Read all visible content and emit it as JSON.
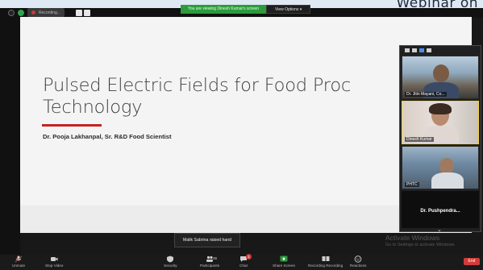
{
  "page": {
    "top_heading_fragment": "Webinar on"
  },
  "meta": {
    "recording_label": "Recording...",
    "viewing_banner": "You are viewing Dinesh Kumar's screen",
    "view_options_label": "View Options ▾"
  },
  "slide": {
    "title": "Pulsed Electric Fields for Food Proc\nTechnology",
    "author": "Dr. Pooja Lakhanpal, Sr. R&D Food Scientist"
  },
  "gallery": {
    "tiles": [
      {
        "name": "Dr. Jitin Mayani, Co..."
      },
      {
        "name": "Dinesh Kumar"
      },
      {
        "name": "PHTC"
      }
    ],
    "active_speaker_name": "Dr. Pushpendra...",
    "scroll_icon": "chevron-down-icon"
  },
  "notification": {
    "text": "Malik Sabrina raised hand"
  },
  "watermark": {
    "title": "Activate Windows",
    "subtitle": "Go to Settings to activate Windows."
  },
  "toolbar": {
    "items": [
      {
        "label": "Unmute",
        "icon": "microphone-icon"
      },
      {
        "label": "Stop Video",
        "icon": "video-camera-icon"
      },
      {
        "label": "Security",
        "icon": "shield-icon"
      },
      {
        "label": "Participants",
        "icon": "participants-icon",
        "count": "36"
      },
      {
        "label": "Chat",
        "icon": "chat-icon",
        "badge": "1"
      },
      {
        "label": "Share Screen",
        "icon": "share-screen-icon"
      },
      {
        "label": "Recording Recording",
        "icon": "recording-icon"
      },
      {
        "label": "Reactions",
        "icon": "smile-icon"
      }
    ],
    "end_label": "End"
  },
  "colors": {
    "accent_green": "#2c9b3c",
    "rule_red": "#c42424",
    "end_red": "#d23b3b",
    "active_blue": "#4a8ff0"
  }
}
